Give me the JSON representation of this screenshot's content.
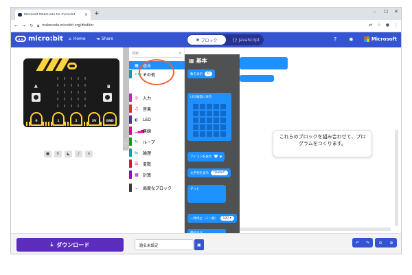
{
  "browser": {
    "tab_title": "Microsoft MakeCode for micro:bit",
    "tab_close": "×",
    "new_tab": "+",
    "url": "makecode.microbit.org/#editor",
    "window_min": "–",
    "window_max": "☐",
    "window_close": "✕"
  },
  "header": {
    "logo": "micro:bit",
    "home": "Home",
    "share": "Share",
    "blocks": "ブロック",
    "javascript": "JavaScript",
    "microsoft": "Microsoft"
  },
  "simulator": {
    "label_a": "A",
    "label_b": "B",
    "pins": [
      "0",
      "1",
      "2",
      "3V",
      "GND"
    ]
  },
  "toolbox": {
    "search_placeholder": "検索...",
    "categories": [
      {
        "label": "基本",
        "color": "#1e90ff"
      },
      {
        "label": "その他",
        "color": "#00a4a6"
      },
      {
        "label": "入力",
        "color": "#c724b1"
      },
      {
        "label": "音楽",
        "color": "#e63022"
      },
      {
        "label": "LED",
        "color": "#5c2d91"
      },
      {
        "label": "無線",
        "color": "#e3008c"
      },
      {
        "label": "ループ",
        "color": "#00aa00"
      },
      {
        "label": "論理",
        "color": "#00a4a6"
      },
      {
        "label": "変数",
        "color": "#dc143c"
      },
      {
        "label": "計算",
        "color": "#9400d3"
      },
      {
        "label": "高度なブロック",
        "color": "#3c3c3c"
      }
    ]
  },
  "flyout": {
    "title": "基本",
    "show_number": "数を表示",
    "show_number_value": "0",
    "show_leds": "LED画面に表示",
    "show_icon": "アイコンを表示",
    "show_string": "文字列を表示",
    "show_string_value": "\"Hello!\"",
    "forever": "ずっと",
    "pause": "一時停止（ミリ秒）",
    "pause_value": "100 ▾",
    "on_start": "最初だけ"
  },
  "workspace": {
    "tip": "これらのブロックを組み合わせて、プログラムをつくります。"
  },
  "bottom": {
    "download": "ダウンロード",
    "project_name": "題名未設定"
  },
  "colors": {
    "header": "#3454d1",
    "download": "#5c2dbd",
    "basic": "#1e90ff",
    "flyout_bg": "#505152",
    "annotation": "#e8643a"
  }
}
